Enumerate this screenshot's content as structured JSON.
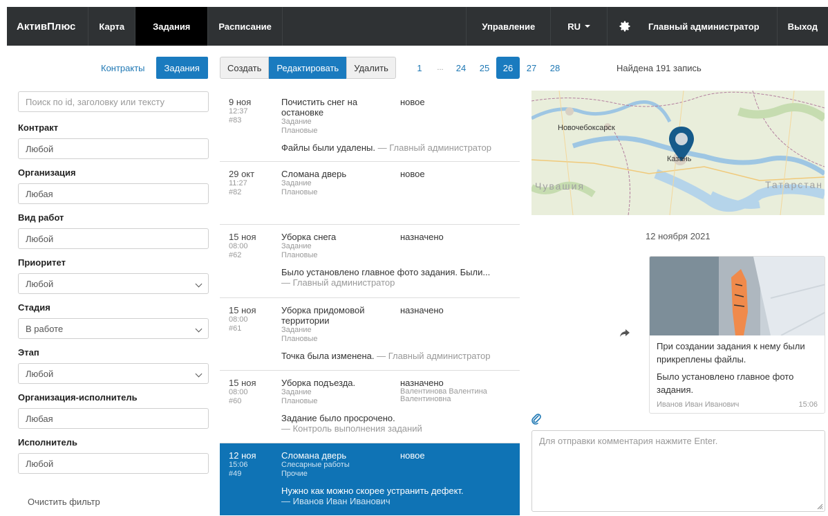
{
  "nav": {
    "brand": "АктивПлюс",
    "map": "Карта",
    "tasks": "Задания",
    "schedule": "Расписание",
    "manage": "Управление",
    "lang": "RU",
    "user": "Главный администратор",
    "logout": "Выход"
  },
  "left_tabs": {
    "contracts": "Контракты",
    "tasks": "Задания"
  },
  "filters": {
    "search_placeholder": "Поиск по id, заголовку или тексту",
    "contract": {
      "label": "Контракт",
      "value": "Любой"
    },
    "organization": {
      "label": "Организация",
      "value": "Любая"
    },
    "work_type": {
      "label": "Вид работ",
      "value": "Любой"
    },
    "priority": {
      "label": "Приоритет",
      "value": "Любой"
    },
    "stage": {
      "label": "Стадия",
      "value": "В работе"
    },
    "step": {
      "label": "Этап",
      "value": "Любой"
    },
    "executor_org": {
      "label": "Организация-исполнитель",
      "value": "Любая"
    },
    "executor": {
      "label": "Исполнитель",
      "value": "Любой"
    },
    "clear": "Очистить фильтр"
  },
  "toolbar": {
    "create": "Создать",
    "edit": "Редактировать",
    "delete": "Удалить"
  },
  "pagination": {
    "pages": [
      "1",
      "...",
      "24",
      "25",
      "26",
      "27",
      "28"
    ],
    "active": "26",
    "found": "Найдена 191 запись"
  },
  "tasks": [
    {
      "date": "9 ноя",
      "time": "12:37",
      "id": "#83",
      "title": "Почистить снег на остановке",
      "type": "Задание",
      "category": "Плановые",
      "status": "новое",
      "assignee": "",
      "note": "Файлы были удалены.",
      "author": "— Главный администратор"
    },
    {
      "date": "29 окт",
      "time": "11:27",
      "id": "#82",
      "title": "Сломана дверь",
      "type": "Задание",
      "category": "Плановые",
      "status": "новое",
      "assignee": "",
      "note": "",
      "author": ""
    },
    {
      "date": "15 ноя",
      "time": "08:00",
      "id": "#62",
      "title": "Уборка снега",
      "type": "Задание",
      "category": "Плановые",
      "status": "назначено",
      "assignee": "",
      "note": "Было установлено главное фото задания. Были...",
      "author": "— Главный администратор"
    },
    {
      "date": "15 ноя",
      "time": "08:00",
      "id": "#61",
      "title": "Уборка придомовой территории",
      "type": "Задание",
      "category": "Плановые",
      "status": "назначено",
      "assignee": "",
      "note": "Точка была изменена.",
      "author": "— Главный администратор"
    },
    {
      "date": "15 ноя",
      "time": "08:00",
      "id": "#60",
      "title": "Уборка подъезда.",
      "type": "Задание",
      "category": "Плановые",
      "status": "назначено",
      "assignee": "Валентинова Валентина Валентиновна",
      "note": "Задание было просрочено.",
      "author": "— Контроль выполнения заданий"
    },
    {
      "date": "12 ноя",
      "time": "15:06",
      "id": "#49",
      "title": "Сломана дверь",
      "type": "Слесарные работы",
      "category": "Прочие",
      "status": "новое",
      "assignee": "",
      "note": "Нужно как можно скорее устранить дефект.",
      "author": "— Иванов Иван Иванович"
    }
  ],
  "map": {
    "city1": "Новочебоксарск",
    "city2": "Казань",
    "region1": "Чувашия",
    "region2": "Татарстан"
  },
  "chat": {
    "date": "12 ноября 2021",
    "message1": "При создании задания к нему были прикреплены файлы.",
    "message2": "Было установлено главное фото задания.",
    "author": "Иванов Иван Иванович",
    "time": "15:06",
    "comment_placeholder": "Для отправки комментария нажмите Enter."
  }
}
